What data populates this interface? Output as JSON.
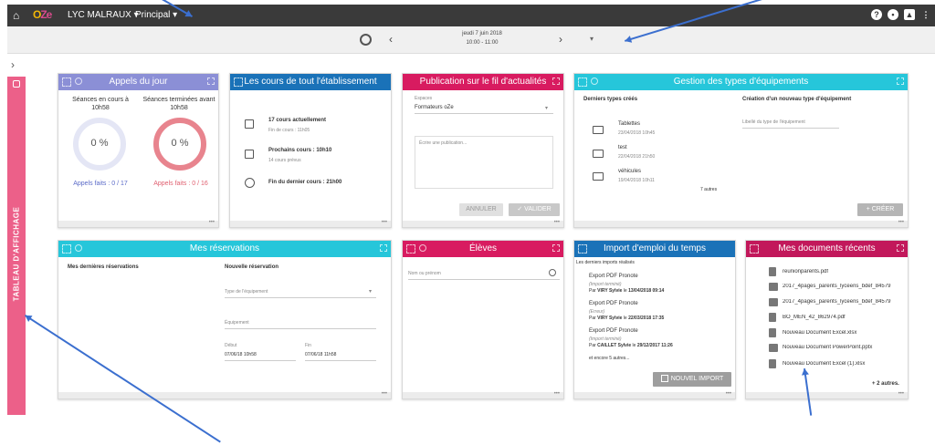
{
  "topbar": {
    "logo_main": "O",
    "logo_accent": "Ze",
    "school": "LYC MALRAUX ▾",
    "menu": "Principal ▾"
  },
  "datebar": {
    "date_line1": "jeudi 7 juin 2018",
    "date_line2": "10:00 - 11:00"
  },
  "side_tab": {
    "label": "TABLEAU D'AFFICHAGE"
  },
  "appels": {
    "title": "Appels du jour",
    "col1_title": "Séances en cours à 10h58",
    "col1_pct": "0 %",
    "col1_caption": "Appels faits : 0 / 17",
    "col2_title": "Séances terminées avant 10h58",
    "col2_pct": "0 %",
    "col2_caption": "Appels faits : 0 / 16",
    "col1_color": "#5b6bc8",
    "col2_color": "#e06070"
  },
  "cours": {
    "title": "Les cours de tout l'établissement",
    "items": [
      {
        "main": "17 cours actuellement",
        "sub": "Fin de cours : 11h05"
      },
      {
        "main": "Prochains cours : 10h10",
        "sub": "14 cours prévus"
      },
      {
        "main": "Fin du dernier cours : 21h00",
        "sub": ""
      }
    ]
  },
  "publication": {
    "title": "Publication sur le fil d'actualités",
    "espaces_label": "Espaces",
    "espace_value": "Formateurs oZe",
    "textarea_placeholder": "Écrire une publication...",
    "cancel": "ANNULER",
    "validate": "✓ VALIDER"
  },
  "equip": {
    "title": "Gestion des types d'équipements",
    "recent_title": "Derniers types créés",
    "items": [
      {
        "name": "Tablettes",
        "date": "23/04/2018 10h45"
      },
      {
        "name": "test",
        "date": "22/04/2018 21h50"
      },
      {
        "name": "véhicules",
        "date": "19/04/2018 10h11"
      }
    ],
    "others": "7 autres",
    "create_title": "Création d'un nouveau type d'équipement",
    "create_placeholder": "Libellé du type de l'équipement",
    "create_button": "+ CRÉER"
  },
  "reservations": {
    "title": "Mes réservations",
    "last_title": "Mes dernières réservations",
    "new_title": "Nouvelle réservation",
    "type_placeholder": "Type de l'équipement",
    "equip_placeholder": "Équipement",
    "start_label": "Début",
    "start_value": "07/06/18 10h58",
    "end_label": "Fin",
    "end_value": "07/06/18 11h58"
  },
  "eleves": {
    "title": "Élèves",
    "search_placeholder": "Nom ou prénom"
  },
  "import": {
    "title": "Import d'emploi du temps",
    "subtitle": "Les derniers imports réalisés",
    "items": [
      {
        "title": "Export PDF Pronote",
        "status": "(Import terminé)",
        "by": "Par",
        "who": "VIRY Sylvie",
        "le": "le",
        "when": "13/04/2018 09:14"
      },
      {
        "title": "Export PDF Pronote",
        "status": "(Erreur)",
        "by": "Par",
        "who": "VIRY Sylvie",
        "le": "le",
        "when": "22/03/2018 17:35"
      },
      {
        "title": "Export PDF Pronote",
        "status": "(Import terminé)",
        "by": "Par",
        "who": "CAILLET Sylvie",
        "le": "le",
        "when": "29/12/2017 11:26"
      }
    ],
    "more": "et encore 5 autres...",
    "button": "NOUVEL IMPORT"
  },
  "docs": {
    "title": "Mes documents récents",
    "items": [
      "reunionparents.pdf",
      "2017_4pages_parents_lyceens_bdef_84579",
      "2017_4pages_parents_lyceens_bdef_84579",
      "BO_MEN_42_862974.pdf",
      "Nouveau Document Excel.xlsx",
      "Nouveau Document PowerPoint.pptx",
      "Nouveau Document Excel (1).xlsx"
    ],
    "more": "+ 2 autres."
  },
  "footer_dots": "•••"
}
